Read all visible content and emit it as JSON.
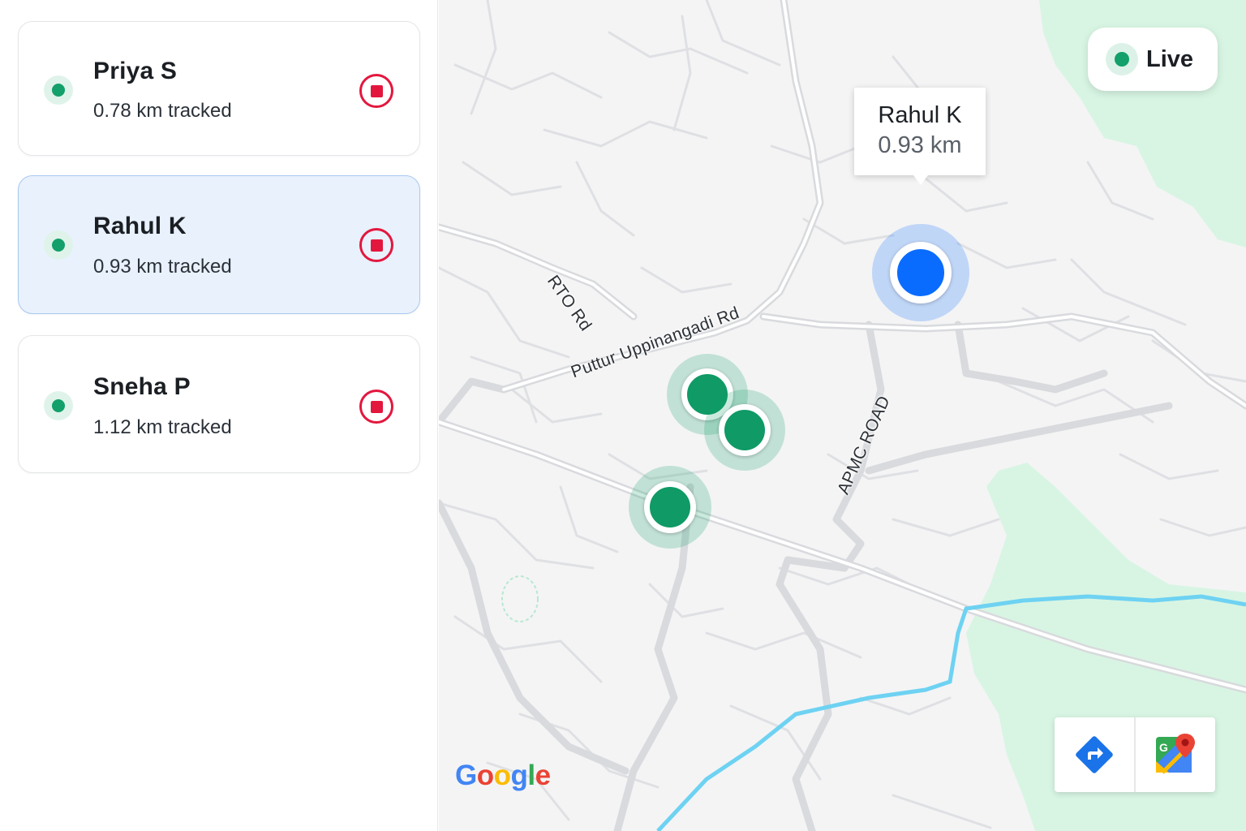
{
  "riders": [
    {
      "name": "Priya S",
      "distance": "0.78 km tracked",
      "status": "live",
      "selected": false
    },
    {
      "name": "Rahul K",
      "distance": "0.93 km tracked",
      "status": "live",
      "selected": true
    },
    {
      "name": "Sneha P",
      "distance": "1.12 km tracked",
      "status": "live",
      "selected": false
    }
  ],
  "map": {
    "live_label": "Live",
    "tooltip": {
      "name": "Rahul K",
      "distance": "0.93 km"
    },
    "road_labels": {
      "rto": "RTO Rd",
      "puttur": "Puttur Uppinangadi Rd",
      "apmc": "APMC ROAD"
    },
    "provider": "Google",
    "buttons": [
      "directions-icon",
      "google-maps-icon"
    ]
  },
  "colors": {
    "live_green": "#13a06a",
    "stop_red": "#e3173e",
    "selected_bg": "#e8f1fc",
    "selected_marker": "#0a6cff",
    "water": "#66d0f0",
    "park": "#d7f5e2"
  }
}
